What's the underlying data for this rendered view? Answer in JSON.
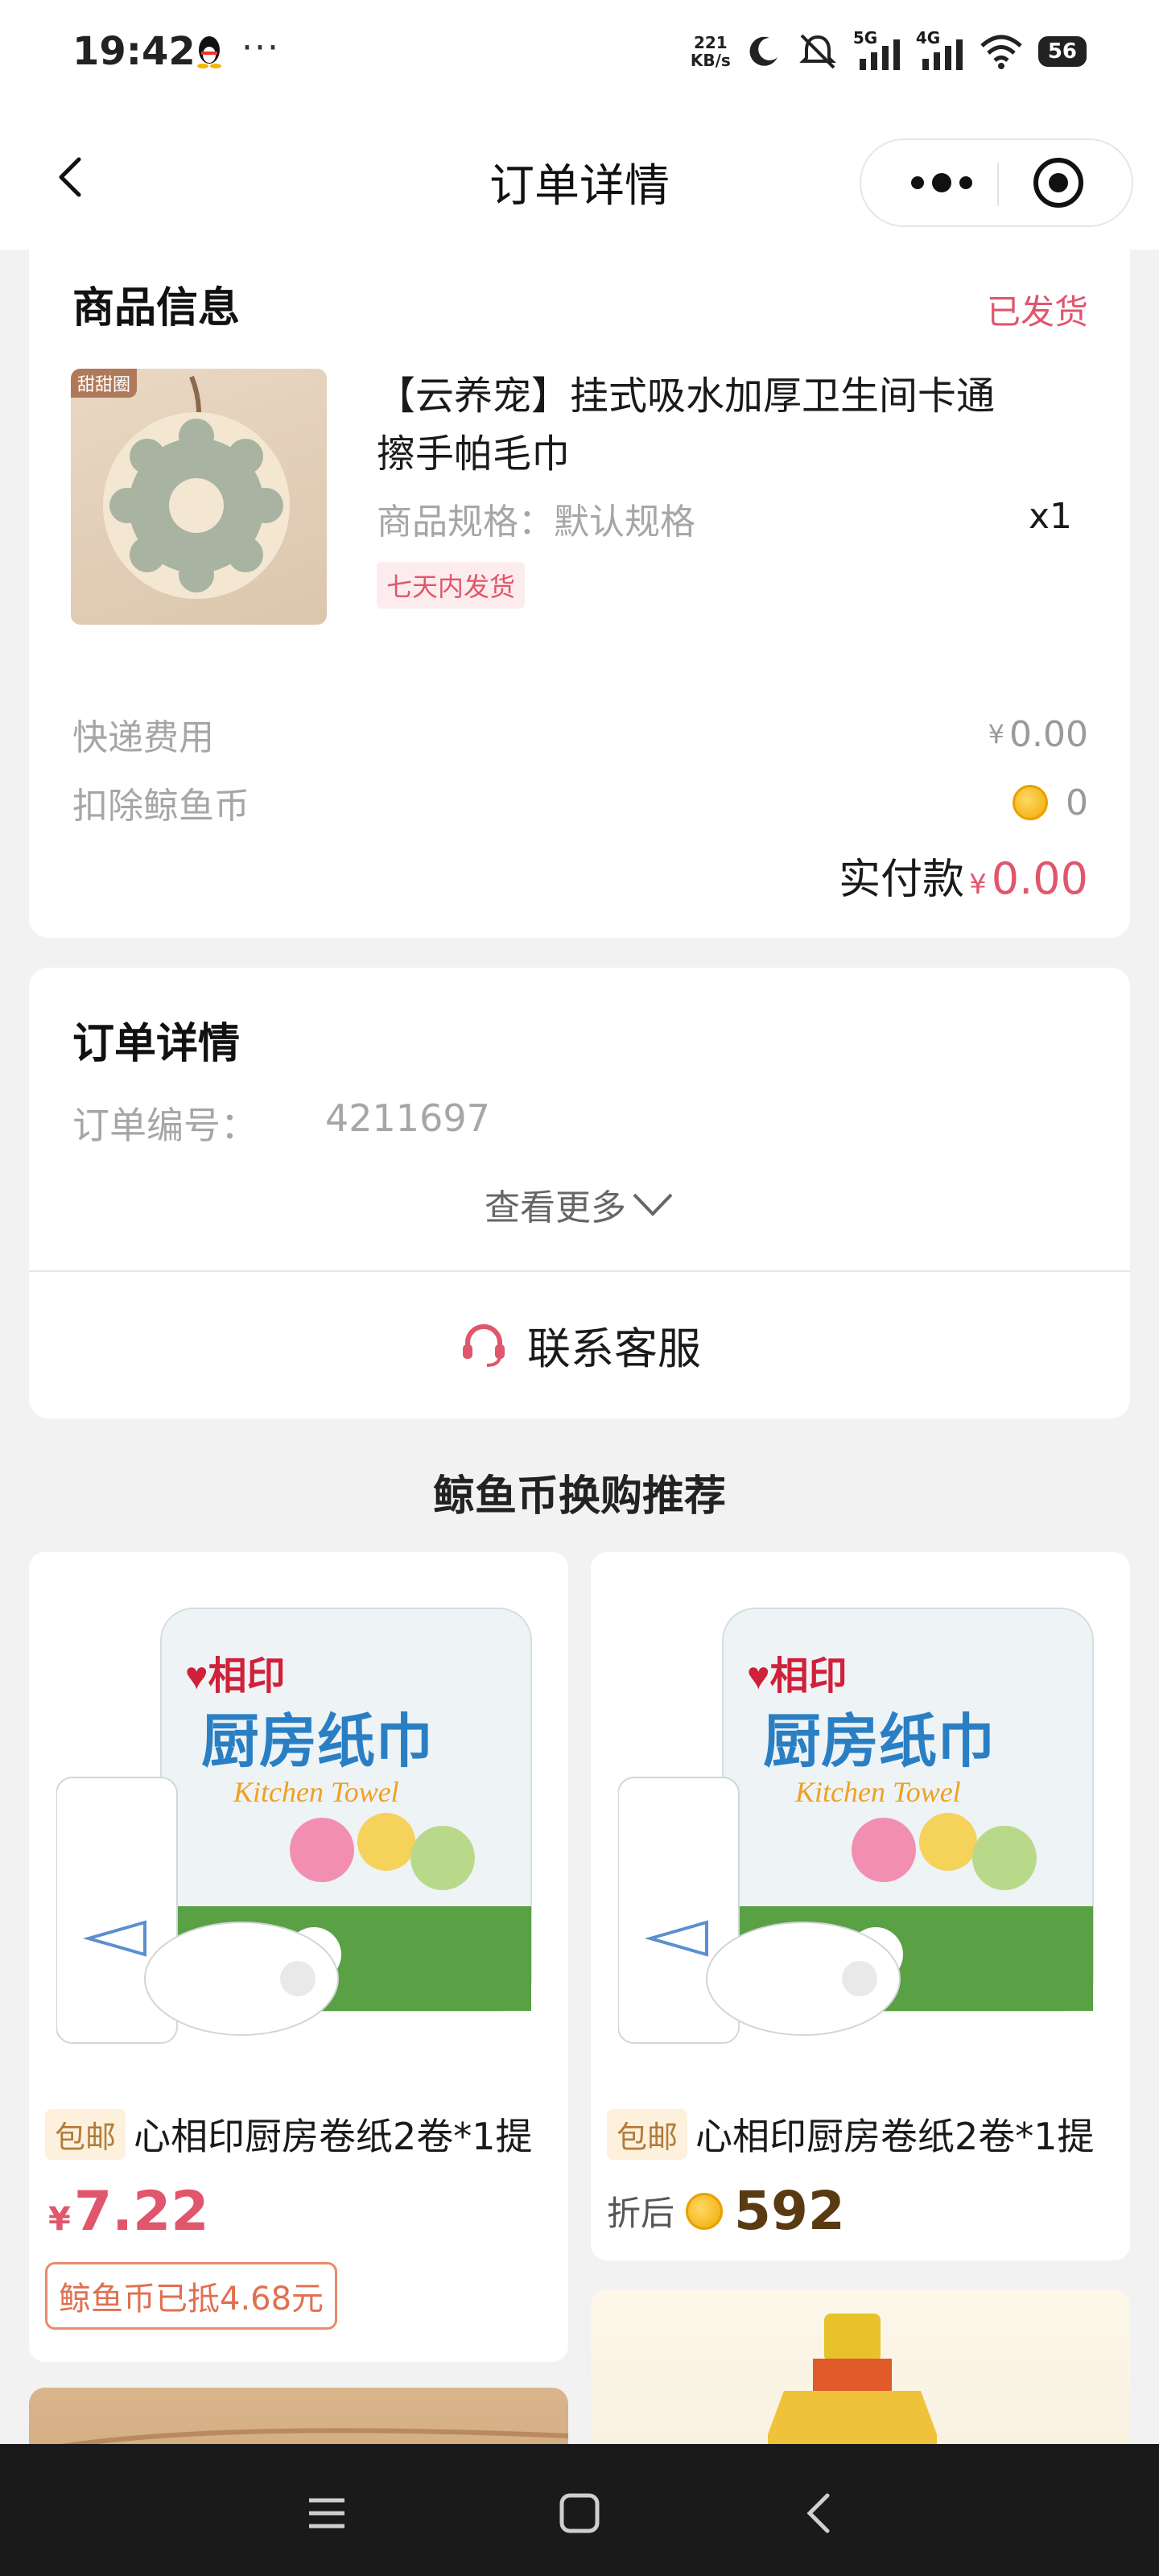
{
  "status_bar": {
    "time": "19:42",
    "network_speed_value": "221",
    "network_speed_unit": "KB/s",
    "signal_1": "5G",
    "signal_2": "4G",
    "battery": "56"
  },
  "nav": {
    "title": "订单详情",
    "back_icon": "chevron-left-icon",
    "more_icon": "more-dots-icon",
    "close_icon": "target-close-icon"
  },
  "product_section": {
    "title": "商品信息",
    "status": "已发货",
    "image_tag": "甜甜圈",
    "product_name": "【云养宠】挂式吸水加厚卫生间卡通擦手帕毛巾",
    "spec": "商品规格：默认规格",
    "quantity": "x1",
    "shipping_tag": "七天内发货",
    "shipping_fee_label": "快递费用",
    "shipping_fee_currency": "¥",
    "shipping_fee_value": "0.00",
    "coin_deduct_label": "扣除鲸鱼币",
    "coin_deduct_value": "0",
    "paid_label": "实付款",
    "paid_currency": "¥",
    "paid_value": "0.00"
  },
  "order_section": {
    "title": "订单详情",
    "order_no_label": "订单编号：",
    "order_no_value": "4211697",
    "see_more": "查看更多",
    "customer_service": "联系客服"
  },
  "recommend": {
    "title": "鲸鱼币换购推荐",
    "items": [
      {
        "tag": "包邮",
        "name": "心相印厨房卷纸2卷*1提",
        "currency": "¥",
        "price": "7.22",
        "deduct_note": "鲸鱼币已抵4.68元"
      },
      {
        "tag": "包邮",
        "name": "心相印厨房卷纸2卷*1提",
        "after_label": "折后",
        "coin_price": "592"
      }
    ]
  },
  "colors": {
    "accent_red": "#e0566c",
    "price_orange": "#e07050",
    "coin_gold": "#f0a900"
  }
}
